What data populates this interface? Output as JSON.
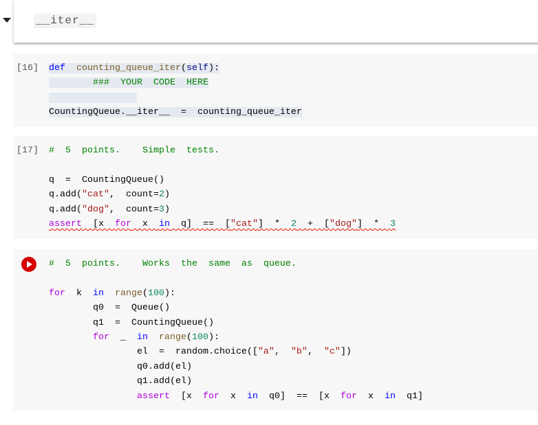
{
  "section": {
    "title": "__iter__"
  },
  "cells": [
    {
      "exec_count": "[16]",
      "highlight": true,
      "lines": [
        [
          [
            "def",
            "kw"
          ],
          [
            " ",
            "plain"
          ],
          [
            "counting_queue_iter",
            "fn"
          ],
          [
            "(",
            "plain"
          ],
          [
            "self",
            "self"
          ],
          [
            "):",
            "plain"
          ]
        ],
        [
          [
            "    ",
            "plain"
          ],
          [
            "### YOUR CODE HERE",
            "com"
          ]
        ],
        [
          [
            "        ",
            "plain"
          ]
        ],
        [
          [
            "CountingQueue.__iter__ = counting_queue_iter",
            "plain"
          ]
        ]
      ]
    },
    {
      "exec_count": "[17]",
      "lines": [
        [
          [
            "# 5 points.  Simple tests.",
            "com"
          ]
        ],
        [],
        [
          [
            "q = CountingQueue()",
            "plain"
          ]
        ],
        [
          [
            "q.add(",
            "plain"
          ],
          [
            "\"cat\"",
            "str"
          ],
          [
            ", count=",
            "plain"
          ],
          [
            "2",
            "num"
          ],
          [
            ")",
            "plain"
          ]
        ],
        [
          [
            "q.add(",
            "plain"
          ],
          [
            "\"dog\"",
            "str"
          ],
          [
            ", count=",
            "plain"
          ],
          [
            "3",
            "num"
          ],
          [
            ")",
            "plain"
          ]
        ],
        [
          [
            "assert",
            "kw2"
          ],
          [
            " [x ",
            "plain"
          ],
          [
            "for",
            "kw2"
          ],
          [
            " x ",
            "plain"
          ],
          [
            "in",
            "kw"
          ],
          [
            " q] == [",
            "plain"
          ],
          [
            "\"cat\"",
            "str"
          ],
          [
            "] * ",
            "plain"
          ],
          [
            "2",
            "num"
          ],
          [
            " + [",
            "plain"
          ],
          [
            "\"dog\"",
            "str"
          ],
          [
            "] * ",
            "plain"
          ],
          [
            "3",
            "num"
          ]
        ]
      ],
      "error_line": 5
    },
    {
      "run_button": "play-icon",
      "lines": [
        [
          [
            "# 5 points.  Works the same as queue.",
            "com"
          ]
        ],
        [],
        [
          [
            "for",
            "kw2"
          ],
          [
            " k ",
            "plain"
          ],
          [
            "in",
            "kw"
          ],
          [
            " ",
            "plain"
          ],
          [
            "range",
            "fn"
          ],
          [
            "(",
            "plain"
          ],
          [
            "100",
            "num"
          ],
          [
            "):",
            "plain"
          ]
        ],
        [
          [
            "    q0 = Queue()",
            "plain"
          ]
        ],
        [
          [
            "    q1 = CountingQueue()",
            "plain"
          ]
        ],
        [
          [
            "    ",
            "plain"
          ],
          [
            "for",
            "kw2"
          ],
          [
            " _ ",
            "plain"
          ],
          [
            "in",
            "kw"
          ],
          [
            " ",
            "plain"
          ],
          [
            "range",
            "fn"
          ],
          [
            "(",
            "plain"
          ],
          [
            "100",
            "num"
          ],
          [
            "):",
            "plain"
          ]
        ],
        [
          [
            "        el = random.choice([",
            "plain"
          ],
          [
            "\"a\"",
            "str"
          ],
          [
            ", ",
            "plain"
          ],
          [
            "\"b\"",
            "str"
          ],
          [
            ", ",
            "plain"
          ],
          [
            "\"c\"",
            "str"
          ],
          [
            "])",
            "plain"
          ]
        ],
        [
          [
            "        q0.add(el)",
            "plain"
          ]
        ],
        [
          [
            "        q1.add(el)",
            "plain"
          ]
        ],
        [
          [
            "        ",
            "plain"
          ],
          [
            "assert",
            "kw2"
          ],
          [
            " [x ",
            "plain"
          ],
          [
            "for",
            "kw2"
          ],
          [
            " x ",
            "plain"
          ],
          [
            "in",
            "kw"
          ],
          [
            " q0] == [x ",
            "plain"
          ],
          [
            "for",
            "kw2"
          ],
          [
            " x ",
            "plain"
          ],
          [
            "in",
            "kw"
          ],
          [
            " q1]",
            "plain"
          ]
        ]
      ]
    }
  ]
}
